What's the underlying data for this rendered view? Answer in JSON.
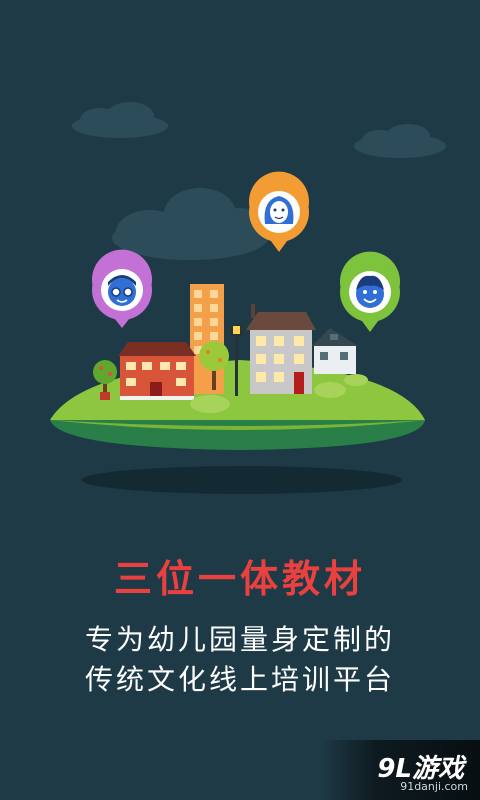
{
  "headline": "三位一体教材",
  "subtitle_line1": "专为幼儿园量身定制的",
  "subtitle_line2": "传统文化线上培训平台",
  "watermark": {
    "logo": "9L游戏",
    "url": "91danji.com"
  },
  "colors": {
    "background": "#1e3a47",
    "headline": "#e8413f",
    "island_grass": "#8dc63f",
    "pin_purple": "#c471d6",
    "pin_orange": "#f39c34",
    "pin_green": "#7dc33c"
  },
  "icons": [
    "user-glasses-icon",
    "user-woman-icon",
    "user-boy-icon",
    "house-icon",
    "tree-icon",
    "street-lamp-icon",
    "cloud-icon"
  ]
}
